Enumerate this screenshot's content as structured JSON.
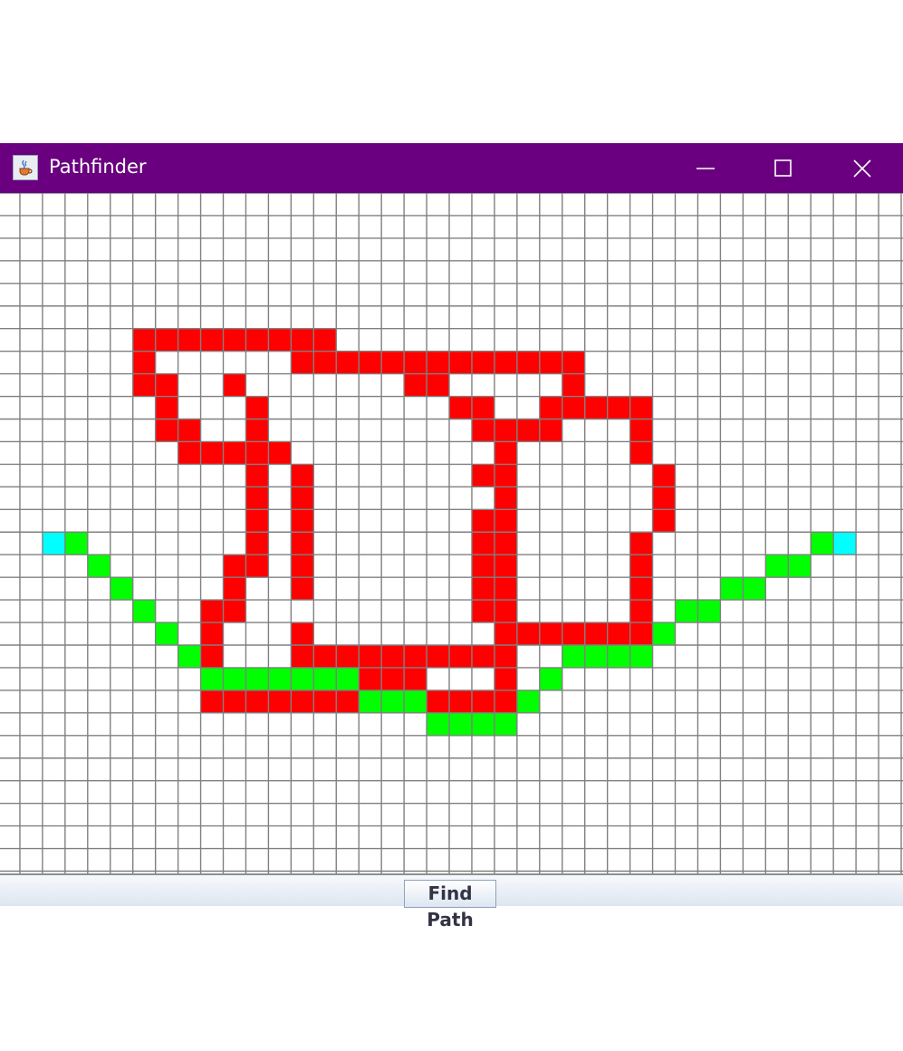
{
  "window": {
    "title": "Pathfinder",
    "icon": "java-cup-icon",
    "titlebar_color": "#6a0080",
    "controls": [
      "minimize-icon",
      "maximize-icon",
      "close-icon"
    ]
  },
  "grid": {
    "columns": 40,
    "rows": 30,
    "colors": {
      "empty": "#ffffff",
      "wall": "#ff0000",
      "path": "#00ff00",
      "endpoint": "#00ffff",
      "gridline": "#808080"
    },
    "endpoints": [
      [
        15,
        2
      ],
      [
        15,
        37
      ]
    ],
    "path_cells": [
      [
        15,
        3
      ],
      [
        16,
        4
      ],
      [
        17,
        5
      ],
      [
        18,
        6
      ],
      [
        19,
        7
      ],
      [
        20,
        8
      ],
      [
        21,
        9
      ],
      [
        21,
        10
      ],
      [
        21,
        11
      ],
      [
        21,
        12
      ],
      [
        21,
        13
      ],
      [
        21,
        14
      ],
      [
        21,
        15
      ],
      [
        22,
        16
      ],
      [
        22,
        17
      ],
      [
        22,
        18
      ],
      [
        23,
        19
      ],
      [
        23,
        20
      ],
      [
        23,
        21
      ],
      [
        23,
        22
      ],
      [
        22,
        23
      ],
      [
        21,
        24
      ],
      [
        20,
        25
      ],
      [
        20,
        26
      ],
      [
        20,
        27
      ],
      [
        20,
        28
      ],
      [
        19,
        29
      ],
      [
        18,
        30
      ],
      [
        18,
        31
      ],
      [
        17,
        32
      ],
      [
        17,
        33
      ],
      [
        16,
        34
      ],
      [
        16,
        35
      ],
      [
        15,
        36
      ]
    ],
    "wall_cells": [
      [
        6,
        6
      ],
      [
        6,
        7
      ],
      [
        6,
        8
      ],
      [
        6,
        9
      ],
      [
        6,
        10
      ],
      [
        6,
        11
      ],
      [
        6,
        12
      ],
      [
        6,
        13
      ],
      [
        6,
        14
      ],
      [
        7,
        6
      ],
      [
        7,
        13
      ],
      [
        7,
        14
      ],
      [
        7,
        15
      ],
      [
        7,
        16
      ],
      [
        7,
        17
      ],
      [
        7,
        18
      ],
      [
        7,
        19
      ],
      [
        7,
        20
      ],
      [
        7,
        21
      ],
      [
        7,
        22
      ],
      [
        7,
        23
      ],
      [
        7,
        24
      ],
      [
        7,
        25
      ],
      [
        8,
        6
      ],
      [
        8,
        7
      ],
      [
        8,
        10
      ],
      [
        8,
        18
      ],
      [
        8,
        19
      ],
      [
        8,
        25
      ],
      [
        9,
        7
      ],
      [
        9,
        11
      ],
      [
        9,
        20
      ],
      [
        9,
        21
      ],
      [
        9,
        24
      ],
      [
        9,
        25
      ],
      [
        9,
        26
      ],
      [
        9,
        27
      ],
      [
        9,
        28
      ],
      [
        10,
        7
      ],
      [
        10,
        8
      ],
      [
        10,
        11
      ],
      [
        10,
        21
      ],
      [
        10,
        22
      ],
      [
        10,
        23
      ],
      [
        10,
        24
      ],
      [
        10,
        28
      ],
      [
        11,
        8
      ],
      [
        11,
        9
      ],
      [
        11,
        10
      ],
      [
        11,
        11
      ],
      [
        11,
        12
      ],
      [
        11,
        22
      ],
      [
        11,
        28
      ],
      [
        12,
        11
      ],
      [
        12,
        13
      ],
      [
        12,
        21
      ],
      [
        12,
        22
      ],
      [
        12,
        29
      ],
      [
        13,
        11
      ],
      [
        13,
        13
      ],
      [
        13,
        22
      ],
      [
        13,
        29
      ],
      [
        14,
        11
      ],
      [
        14,
        13
      ],
      [
        14,
        21
      ],
      [
        14,
        22
      ],
      [
        14,
        29
      ],
      [
        15,
        11
      ],
      [
        15,
        13
      ],
      [
        15,
        21
      ],
      [
        15,
        22
      ],
      [
        15,
        28
      ],
      [
        16,
        10
      ],
      [
        16,
        11
      ],
      [
        16,
        13
      ],
      [
        16,
        21
      ],
      [
        16,
        22
      ],
      [
        16,
        28
      ],
      [
        17,
        10
      ],
      [
        17,
        13
      ],
      [
        17,
        21
      ],
      [
        17,
        22
      ],
      [
        17,
        28
      ],
      [
        18,
        9
      ],
      [
        18,
        10
      ],
      [
        18,
        21
      ],
      [
        18,
        22
      ],
      [
        18,
        28
      ],
      [
        19,
        9
      ],
      [
        19,
        13
      ],
      [
        19,
        22
      ],
      [
        19,
        23
      ],
      [
        19,
        24
      ],
      [
        19,
        25
      ],
      [
        19,
        26
      ],
      [
        19,
        27
      ],
      [
        19,
        28
      ],
      [
        20,
        9
      ],
      [
        20,
        13
      ],
      [
        20,
        14
      ],
      [
        20,
        15
      ],
      [
        20,
        16
      ],
      [
        20,
        17
      ],
      [
        20,
        18
      ],
      [
        20,
        19
      ],
      [
        20,
        20
      ],
      [
        20,
        21
      ],
      [
        20,
        22
      ],
      [
        21,
        16
      ],
      [
        21,
        17
      ],
      [
        21,
        18
      ],
      [
        21,
        22
      ],
      [
        22,
        9
      ],
      [
        22,
        10
      ],
      [
        22,
        11
      ],
      [
        22,
        12
      ],
      [
        22,
        13
      ],
      [
        22,
        14
      ],
      [
        22,
        15
      ],
      [
        22,
        19
      ],
      [
        22,
        20
      ],
      [
        22,
        21
      ],
      [
        22,
        22
      ]
    ]
  },
  "bottom_bar": {
    "find_path_label": "Find Path"
  }
}
